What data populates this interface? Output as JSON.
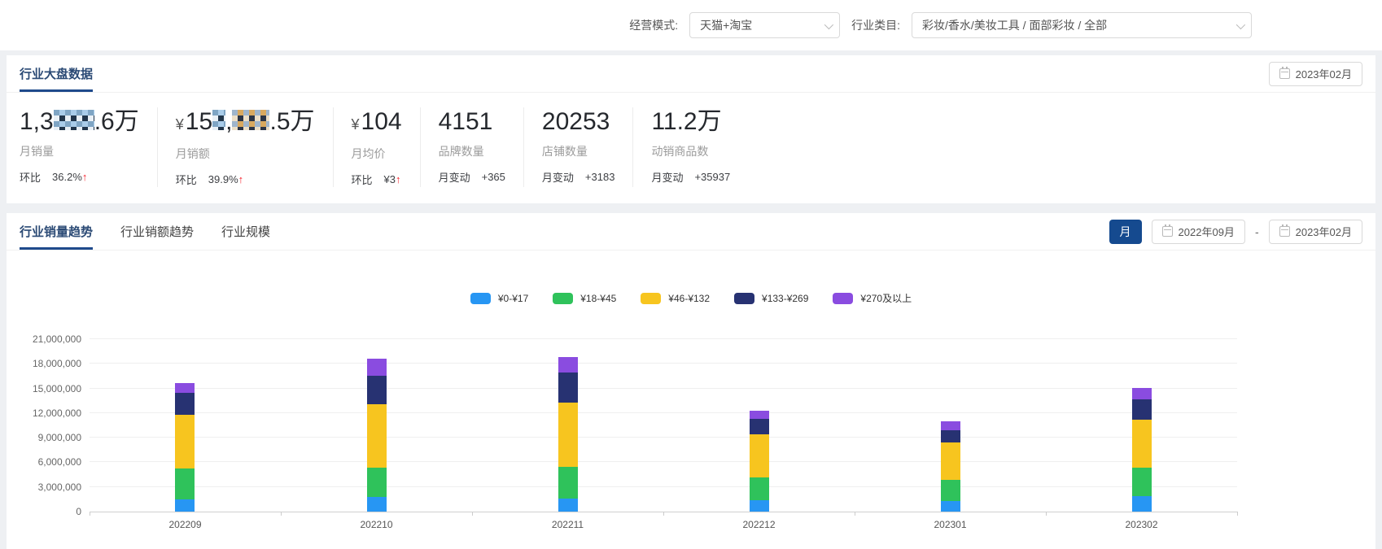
{
  "filters": {
    "business_mode": {
      "label": "经营模式:",
      "value": "天猫+淘宝"
    },
    "category": {
      "label": "行业类目:",
      "value": "彩妆/香水/美妆工具 / 面部彩妆 / 全部"
    }
  },
  "overview": {
    "tab": "行业大盘数据",
    "date": "2023年02月",
    "kpis": [
      {
        "label": "月销量",
        "parts": [
          {
            "t": "text",
            "v": "1,3"
          },
          {
            "t": "mask",
            "w": 50,
            "p": 1
          },
          {
            "t": "text",
            "v": ".6万"
          }
        ],
        "sub_label": "环比",
        "sub_value": "36.2%",
        "trend": "up"
      },
      {
        "label": "月销额",
        "parts": [
          {
            "t": "cur",
            "v": "¥"
          },
          {
            "t": "text",
            "v": "15"
          },
          {
            "t": "mask",
            "w": 16,
            "p": 1
          },
          {
            "t": "text",
            "v": ","
          },
          {
            "t": "mask",
            "w": 46,
            "p": 2
          },
          {
            "t": "text",
            "v": ".5万"
          }
        ],
        "sub_label": "环比",
        "sub_value": "39.9%",
        "trend": "up"
      },
      {
        "label": "月均价",
        "parts": [
          {
            "t": "cur",
            "v": "¥"
          },
          {
            "t": "text",
            "v": "104"
          }
        ],
        "sub_label": "环比",
        "sub_value": "¥3",
        "trend": "up"
      },
      {
        "label": "品牌数量",
        "parts": [
          {
            "t": "text",
            "v": "4151"
          }
        ],
        "sub_label": "月变动",
        "sub_value": "+365"
      },
      {
        "label": "店铺数量",
        "parts": [
          {
            "t": "text",
            "v": "20253"
          }
        ],
        "sub_label": "月变动",
        "sub_value": "+3183"
      },
      {
        "label": "动销商品数",
        "parts": [
          {
            "t": "text",
            "v": "11.2万"
          }
        ],
        "sub_label": "月变动",
        "sub_value": "+35937"
      }
    ]
  },
  "trend": {
    "tabs": [
      "行业销量趋势",
      "行业销额趋势",
      "行业规模"
    ],
    "active_tab": "行业销量趋势",
    "period_button": "月",
    "date_start": "2022年09月",
    "date_separator": "-",
    "date_end": "2023年02月"
  },
  "chart_data": {
    "type": "bar",
    "stacked": true,
    "title": "行业销量趋势",
    "categories": [
      "202209",
      "202210",
      "202211",
      "202212",
      "202301",
      "202302"
    ],
    "series": [
      {
        "name": "¥0-¥17",
        "color": "#2796f3",
        "values": [
          1500000,
          1800000,
          1600000,
          1400000,
          1250000,
          1900000
        ]
      },
      {
        "name": "¥18-¥45",
        "color": "#2fc25b",
        "values": [
          3800000,
          3600000,
          3900000,
          2800000,
          2650000,
          3500000
        ]
      },
      {
        "name": "¥46-¥132",
        "color": "#f7c51f",
        "values": [
          6500000,
          7700000,
          7800000,
          5200000,
          4500000,
          5800000
        ]
      },
      {
        "name": "¥133-¥269",
        "color": "#273272",
        "values": [
          2700000,
          3400000,
          3600000,
          1900000,
          1500000,
          2500000
        ]
      },
      {
        "name": "¥270及以上",
        "color": "#8a4ce0",
        "values": [
          1200000,
          2100000,
          1900000,
          1000000,
          1100000,
          1400000
        ]
      }
    ],
    "ylim": [
      0,
      21000000
    ],
    "ytick_step": 3000000,
    "grid": true,
    "legend_position": "top"
  },
  "colors": {
    "accent_blue": "#154a8f",
    "tab_underline": "#1f4a8c",
    "arrow_red": "#f5222d"
  }
}
